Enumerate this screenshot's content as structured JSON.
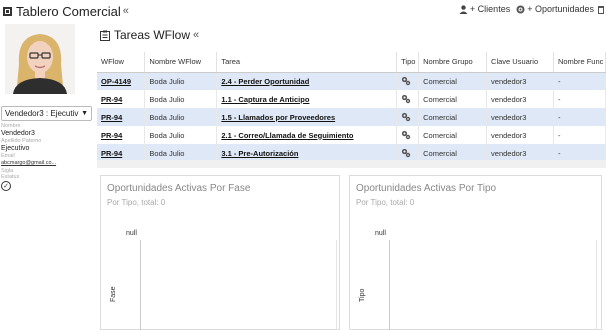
{
  "header": {
    "title": "Tablero Comercial",
    "collapse": "«",
    "actions": [
      {
        "label": "+ Clientes",
        "icon": "user-icon"
      },
      {
        "label": "+ Oportunidades",
        "icon": "globe-icon"
      }
    ]
  },
  "sidebar": {
    "role_select": "Vendedor3 : Ejecutiv",
    "profile": [
      {
        "label": "Nombre",
        "value": "Vendedor3"
      },
      {
        "label": "Apellido Paterno",
        "value": "Ejecutivo"
      },
      {
        "label": "Email",
        "value": "abcmargo@gmail.co..."
      },
      {
        "label": "Sigla",
        "value": ""
      },
      {
        "label": "Estatus",
        "value": ""
      }
    ]
  },
  "tasks": {
    "title": "Tareas WFlow",
    "collapse": "«",
    "columns": [
      "WFlow",
      "Nombre WFlow",
      "Tarea",
      "Tipo",
      "Nombre Grupo",
      "Clave Usuario",
      "Nombre Func"
    ],
    "rows": [
      {
        "wflow": "OP-4149",
        "nombre": "Boda Julio",
        "tarea": "2.4 - Perder Oportunidad",
        "grupo": "Comercial",
        "clave": "vendedor3",
        "func": "-"
      },
      {
        "wflow": "PR-94",
        "nombre": "Boda Julio",
        "tarea": "1.1 - Captura de Anticipo",
        "grupo": "Comercial",
        "clave": "vendedor3",
        "func": "-"
      },
      {
        "wflow": "PR-94",
        "nombre": "Boda Julio",
        "tarea": "1.5 - Llamados por Proveedores",
        "grupo": "Comercial",
        "clave": "vendedor3",
        "func": "-"
      },
      {
        "wflow": "PR-94",
        "nombre": "Boda Julio",
        "tarea": "2.1 - Correo/Llamada de Seguimiento",
        "grupo": "Comercial",
        "clave": "vendedor3",
        "func": "-"
      },
      {
        "wflow": "PR-94",
        "nombre": "Boda Julio",
        "tarea": "3.1 - Pre-Autorización",
        "grupo": "Comercial",
        "clave": "vendedor3",
        "func": "-"
      }
    ]
  },
  "panels": {
    "fase": {
      "title": "Oportunidades Activas Por Fase",
      "subtitle": "Por Tipo, total: 0",
      "null_label": "null",
      "axis_label": "Fase"
    },
    "tipo": {
      "title": "Oportunidades Activas Por Tipo",
      "subtitle": "Por Tipo, total: 0",
      "null_label": "null",
      "axis_label": "Tipo"
    }
  },
  "colors": {
    "row_highlight": "#dfe8f6",
    "border": "#dcdcdc"
  }
}
